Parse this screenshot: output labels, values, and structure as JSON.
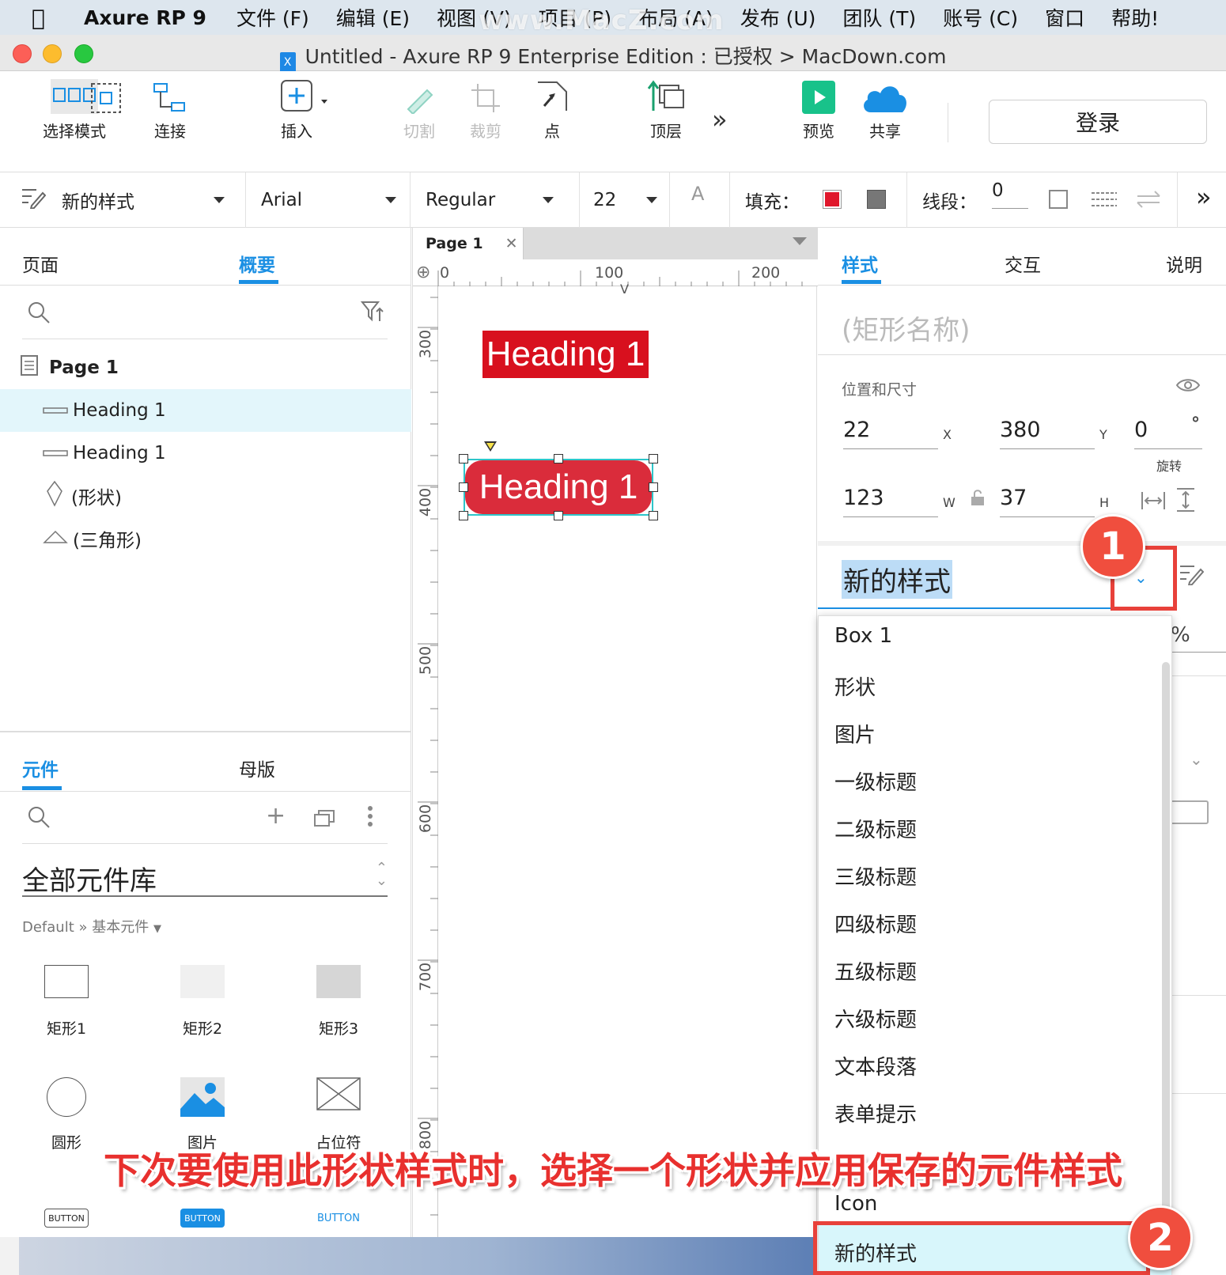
{
  "menubar": {
    "app": "Axure RP 9",
    "items": [
      "文件 (F)",
      "编辑 (E)",
      "视图 (V)",
      "项目 (P)",
      "布局 (A)",
      "发布 (U)",
      "团队 (T)",
      "账号 (C)",
      "窗口",
      "帮助!"
    ],
    "watermark": "www.MacZ.com"
  },
  "window": {
    "title": "Untitled - Axure RP 9 Enterprise Edition : 已授权 > MacDown.com"
  },
  "toolbar": {
    "select_mode": "选择模式",
    "connect": "连接",
    "insert": "插入",
    "cut": "切割",
    "crop": "裁剪",
    "point": "点",
    "top_layer": "顶层",
    "preview": "预览",
    "share": "共享",
    "login": "登录"
  },
  "formatbar": {
    "style": "新的样式",
    "font": "Arial",
    "weight": "Regular",
    "size": "22",
    "fill_label": "填充：",
    "line_label": "线段：",
    "line_value": "0",
    "fill_color": "#e0182c"
  },
  "left_top": {
    "tabs": [
      "页面",
      "概要"
    ],
    "page": "Page 1",
    "items": [
      "Heading 1",
      "Heading 1",
      "(形状)",
      "(三角形)"
    ]
  },
  "left_bottom": {
    "tabs": [
      "元件",
      "母版"
    ],
    "library": "全部元件库",
    "breadcrumb": "Default » 基本元件",
    "widgets": [
      "矩形1",
      "矩形2",
      "矩形3",
      "圆形",
      "图片",
      "占位符"
    ],
    "buttons": [
      "BUTTON",
      "BUTTON",
      "BUTTON"
    ]
  },
  "canvas": {
    "tab": "Page 1",
    "ruler_h": [
      "0",
      "100",
      "200"
    ],
    "ruler_v": [
      "300",
      "400",
      "500",
      "600",
      "700",
      "800"
    ],
    "heading_a": "Heading 1",
    "heading_b": "Heading 1"
  },
  "right": {
    "tabs": [
      "样式",
      "交互",
      "说明"
    ],
    "shape_name_placeholder": "(矩形名称)",
    "pos_size_label": "位置和尺寸",
    "x": "22",
    "x_unit": "X",
    "y": "380",
    "y_unit": "Y",
    "rotate": "0",
    "rotate_unit": "°",
    "rotate_label": "旋转",
    "w": "123",
    "w_unit": "W",
    "h": "37",
    "h_unit": "H",
    "style_value": "新的样式",
    "percent": "%"
  },
  "dropdown": {
    "items": [
      "Box 1",
      "形状",
      "图片",
      "一级标题",
      "二级标题",
      "三级标题",
      "四级标题",
      "五级标题",
      "六级标题",
      "文本段落",
      "表单提示",
      "Icon",
      "新的样式"
    ]
  },
  "annotation": {
    "caption": "下次要使用此形状样式时，选择一个形状并应用保存的元件样式",
    "badge1": "1",
    "badge2": "2"
  }
}
